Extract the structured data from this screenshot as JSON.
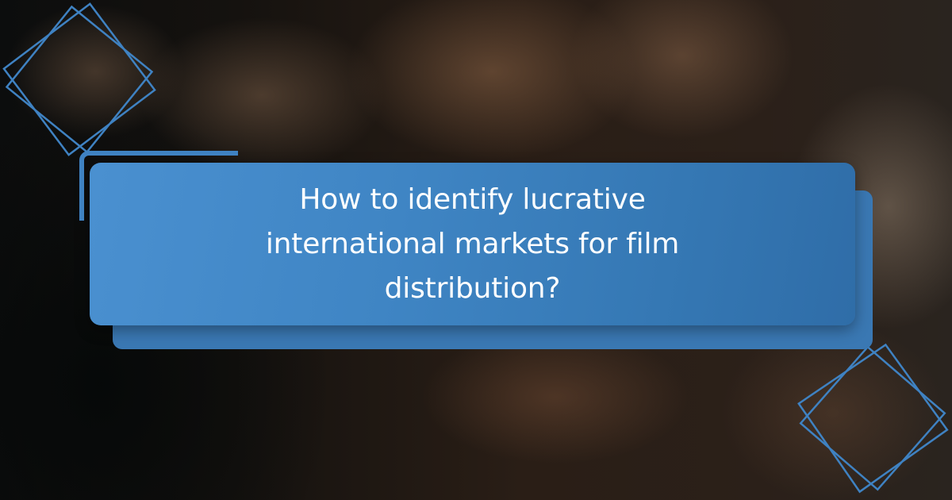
{
  "headline": {
    "text": "How to identify lucrative international markets for film distribution?"
  },
  "colors": {
    "card_primary": "#4a90d0",
    "card_secondary": "#2f6da8",
    "decor_stroke": "#3f82c2",
    "text": "#ffffff"
  },
  "icons": {
    "top_left": "diamond-outline-icon",
    "bottom_right": "diamond-outline-icon"
  }
}
